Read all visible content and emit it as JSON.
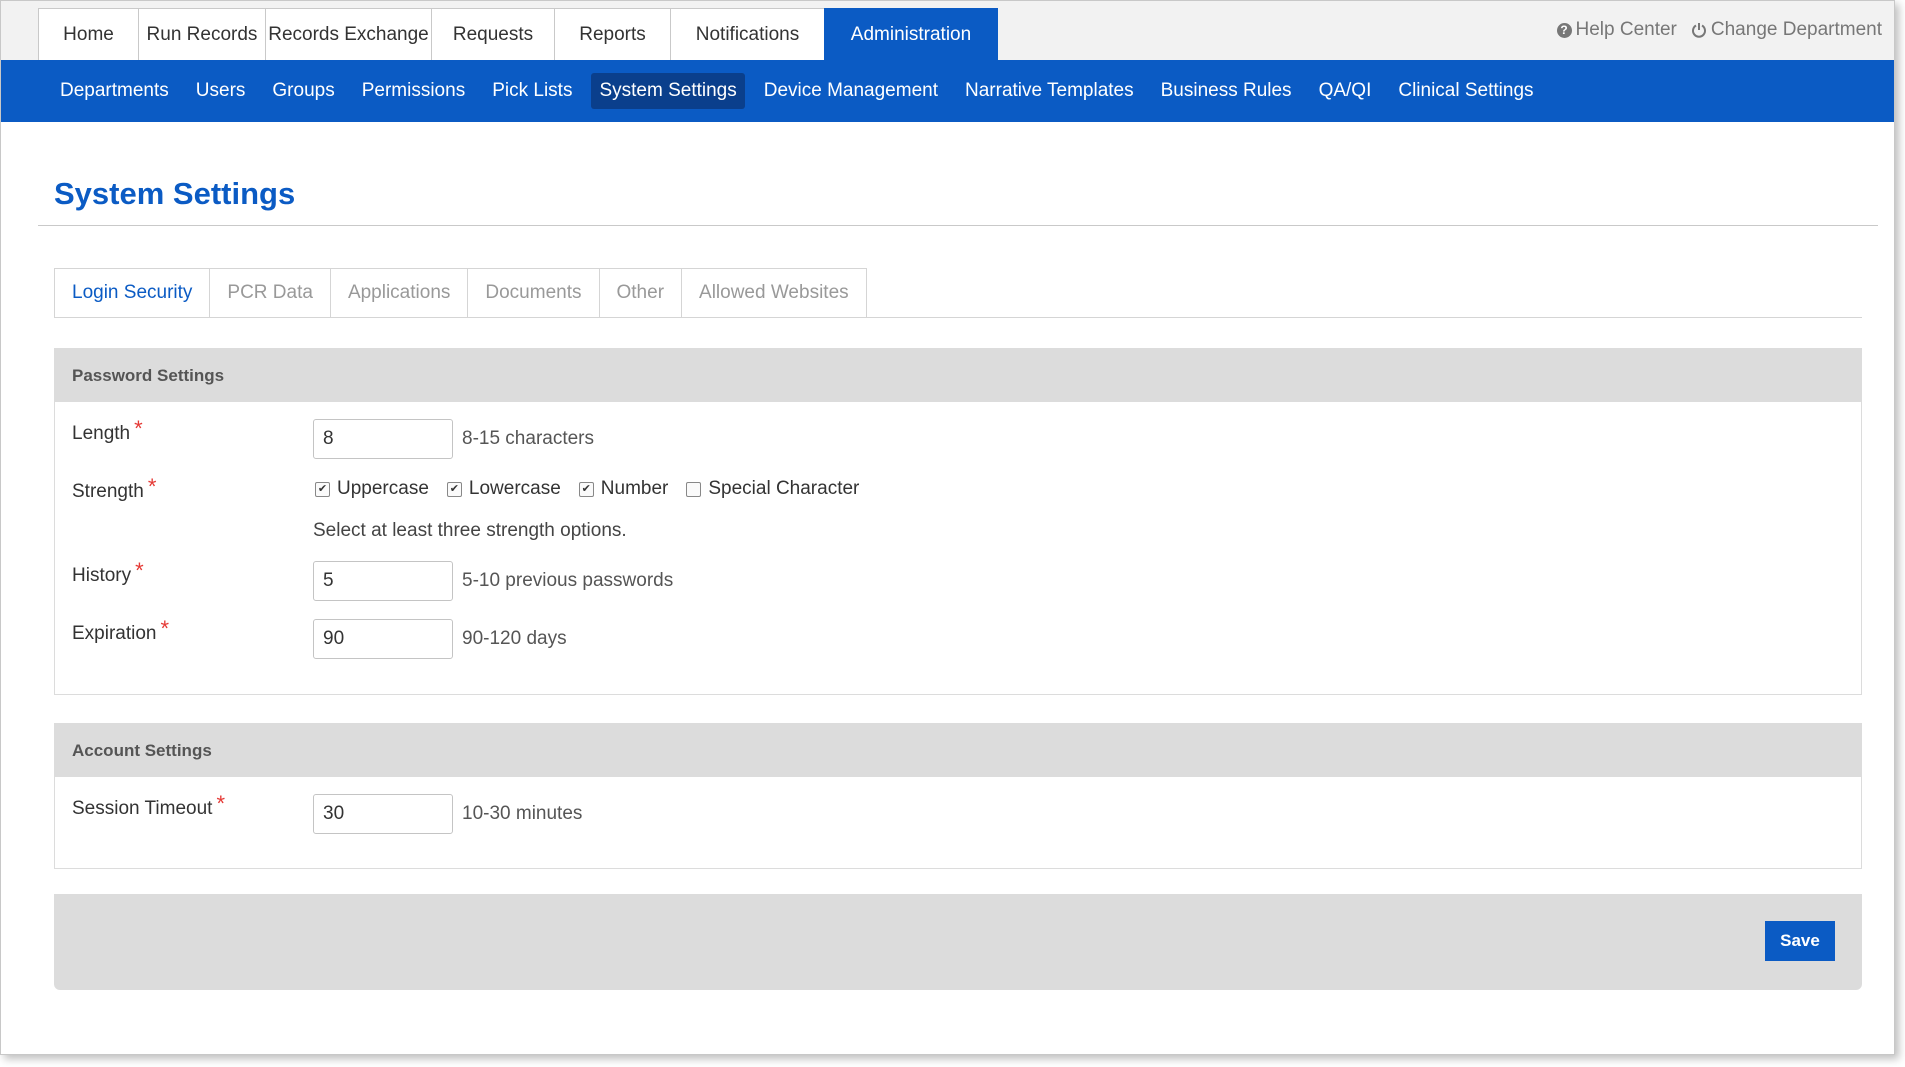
{
  "top_nav": {
    "tabs": [
      {
        "label": "Home",
        "active": false
      },
      {
        "label": "Run Records",
        "active": false
      },
      {
        "label": "Records Exchange",
        "active": false
      },
      {
        "label": "Requests",
        "active": false
      },
      {
        "label": "Reports",
        "active": false
      },
      {
        "label": "Notifications",
        "active": false
      },
      {
        "label": "Administration",
        "active": true
      }
    ],
    "help_center": "Help Center",
    "change_department": "Change Department"
  },
  "sub_nav": {
    "items": [
      {
        "label": "Departments",
        "active": false
      },
      {
        "label": "Users",
        "active": false
      },
      {
        "label": "Groups",
        "active": false
      },
      {
        "label": "Permissions",
        "active": false
      },
      {
        "label": "Pick Lists",
        "active": false
      },
      {
        "label": "System Settings",
        "active": true
      },
      {
        "label": "Device Management",
        "active": false
      },
      {
        "label": "Narrative Templates",
        "active": false
      },
      {
        "label": "Business Rules",
        "active": false
      },
      {
        "label": "QA/QI",
        "active": false
      },
      {
        "label": "Clinical Settings",
        "active": false
      }
    ]
  },
  "page": {
    "title": "System Settings",
    "tabs": [
      {
        "label": "Login Security",
        "active": true
      },
      {
        "label": "PCR Data",
        "active": false
      },
      {
        "label": "Applications",
        "active": false
      },
      {
        "label": "Documents",
        "active": false
      },
      {
        "label": "Other",
        "active": false
      },
      {
        "label": "Allowed Websites",
        "active": false
      }
    ]
  },
  "password_settings": {
    "heading": "Password Settings",
    "required_mark": "*",
    "length": {
      "label": "Length",
      "value": "8",
      "hint": "8-15 characters"
    },
    "strength": {
      "label": "Strength",
      "options": [
        {
          "label": "Uppercase",
          "checked": true
        },
        {
          "label": "Lowercase",
          "checked": true
        },
        {
          "label": "Number",
          "checked": true
        },
        {
          "label": "Special Character",
          "checked": false
        }
      ],
      "hint": "Select at least three strength options."
    },
    "history": {
      "label": "History",
      "value": "5",
      "hint": "5-10 previous passwords"
    },
    "expiration": {
      "label": "Expiration",
      "value": "90",
      "hint": "90-120 days"
    }
  },
  "account_settings": {
    "heading": "Account Settings",
    "session_timeout": {
      "label": "Session Timeout",
      "value": "30",
      "hint": "10-30 minutes"
    }
  },
  "footer": {
    "save_label": "Save"
  },
  "colors": {
    "accent": "#0b5bc4",
    "accent_dark": "#0a3f8c",
    "required": "#e53935",
    "panel_header": "#dcdcdc"
  }
}
